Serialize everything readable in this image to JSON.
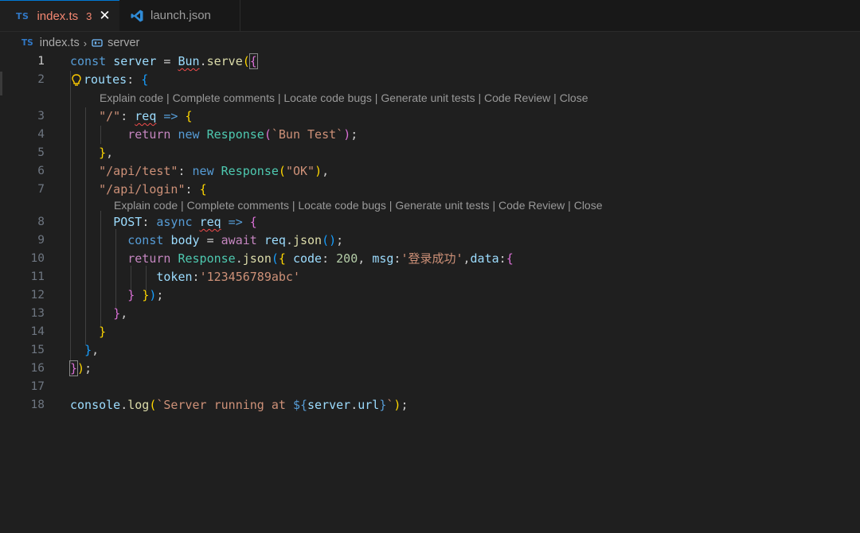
{
  "tabs": [
    {
      "lang": "TS",
      "label": "index.ts",
      "problems": "3",
      "close": "✕"
    },
    {
      "label": "launch.json"
    }
  ],
  "breadcrumb": {
    "lang": "TS",
    "file": "index.ts",
    "separator": "›",
    "symbol": "server"
  },
  "code_lens": "Explain code | Complete comments | Locate code bugs | Generate unit tests | Code Review | Close",
  "line_numbers": [
    "1",
    "2",
    "3",
    "4",
    "5",
    "6",
    "7",
    "8",
    "9",
    "10",
    "11",
    "12",
    "13",
    "14",
    "15",
    "16",
    "17",
    "18"
  ],
  "code": {
    "l1": {
      "const": "const",
      "server": "server",
      "eq": " = ",
      "bun": "Bun",
      "dot": ".",
      "serve": "serve",
      "paren": "(",
      "brace": "{"
    },
    "l2": {
      "routes": "routes",
      "colon": ": ",
      "brace": "{"
    },
    "l3": {
      "path": "\"/\"",
      "colon": ": ",
      "req": "req",
      "arrow": " => ",
      "brace": "{"
    },
    "l4": {
      "return": "return",
      "new": "new",
      "response": "Response",
      "paren_open": "(",
      "str": "`Bun Test`",
      "paren_close": ")",
      "semi": ";"
    },
    "l5": {
      "brace": "}",
      "comma": ","
    },
    "l6": {
      "path": "\"/api/test\"",
      "colon": ": ",
      "new": "new",
      "response": "Response",
      "paren_open": "(",
      "str": "\"OK\"",
      "paren_close": ")",
      "comma": ","
    },
    "l7": {
      "path": "\"/api/login\"",
      "colon": ": ",
      "brace": "{"
    },
    "l8": {
      "post": "POST",
      "colon": ": ",
      "async": "async",
      "req": "req",
      "arrow": " => ",
      "brace": "{"
    },
    "l9": {
      "const": "const",
      "body": "body",
      "eq": " = ",
      "await": "await",
      "req": "req",
      "dot": ".",
      "json": "json",
      "parens": "()",
      "semi": ";"
    },
    "l10": {
      "return": "return",
      "response": "Response",
      "dot": ".",
      "json": "json",
      "paren": "(",
      "brace": "{",
      "code_key": " code",
      "colon1": ": ",
      "code_val": "200",
      "sep1": ", ",
      "msg_key": "msg",
      "colon2": ":",
      "msg_val": "'登录成功'",
      "sep2": ",",
      "data_key": "data",
      "colon3": ":",
      "brace2": "{"
    },
    "l11": {
      "token_key": "token",
      "colon": ":",
      "token_val": "'123456789abc'"
    },
    "l12": {
      "brace2": "}",
      "space": " ",
      "brace": "}",
      "paren": ")",
      "semi": ";"
    },
    "l13": {
      "brace": "}",
      "comma": ","
    },
    "l14": {
      "brace": "}"
    },
    "l15": {
      "brace": "}",
      "comma": ","
    },
    "l16": {
      "brace": "}",
      "paren": ")",
      "semi": ";"
    },
    "l18": {
      "console": "console",
      "dot": ".",
      "log": "log",
      "paren_open": "(",
      "str1": "`Server running at ",
      "interp_open": "${",
      "server": "server",
      "dot2": ".",
      "url": "url",
      "interp_close": "}",
      "str2": "`",
      "paren_close": ")",
      "semi": ";"
    }
  },
  "colors": {
    "accent": "#0078d4",
    "ts_blue": "#3178c6",
    "modified": "#f48771",
    "editor_bg": "#1f1f1f"
  }
}
